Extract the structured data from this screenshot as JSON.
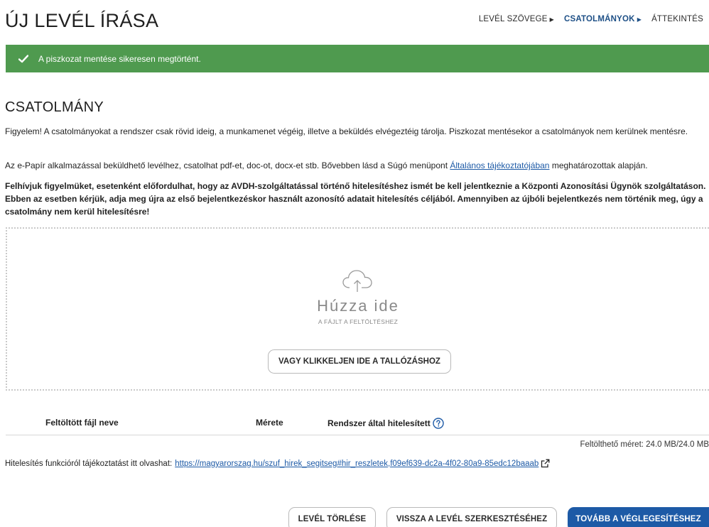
{
  "header": {
    "title": "ÚJ LEVÉL ÍRÁSA",
    "steps": [
      {
        "label": "LEVÉL SZÖVEGE",
        "arrow": "▶",
        "active": false
      },
      {
        "label": "CSATOLMÁNYOK",
        "arrow": "▶",
        "active": true
      },
      {
        "label": "ÁTTEKINTÉS",
        "active": false
      }
    ]
  },
  "alert": {
    "text": "A piszkozat mentése sikeresen megtörtént.",
    "color": "#4f9a4f"
  },
  "attachment": {
    "title": "CSATOLMÁNY",
    "paragraph1": "Figyelem! A csatolmányokat a rendszer csak rövid ideig, a munkamenet végéig, illetve a beküldés elvégeztéig tárolja. Piszkozat mentésekor a csatolmányok nem kerülnek mentésre.",
    "paragraph2_before": "Az e-Papír alkalmazással beküldhető levélhez, csatolhat pdf-et, doc-ot, docx-et stb. Bővebben lásd a Súgó menüpont ",
    "paragraph2_link": "Általános tájékoztatójában",
    "paragraph2_after": " meghatározottak alapján.",
    "paragraph3": "Felhívjuk figyelmüket, esetenként előfordulhat, hogy az AVDH-szolgáltatással történő hitelesítéshez ismét be kell jelentkeznie a Központi Azonosítási Ügynök szolgáltatáson. Ebben az esetben kérjük, adja meg újra az első bejelentkezéskor használt azonosító adatait hitelesítés céljából. Amennyiben az újbóli bejelentkezés nem történik meg, úgy a csatolmány nem kerül hitelesítésre!"
  },
  "dropzone": {
    "main_text": "Húzza ide",
    "sub_text": "A FÁJLT A FELTÖLTÉSHEZ",
    "browse_label": "VAGY KLIKKELJEN IDE A TALLÓZÁSHOZ"
  },
  "file_table": {
    "columns": [
      "Feltöltött fájl neve",
      "Mérete",
      "Rendszer által hitelesített"
    ]
  },
  "capacity_text": "Feltölthető méret: 24.0 MB/24.0 MB",
  "info": {
    "text": "Hitelesítés funkcióról tájékoztatást itt olvashat:",
    "link": "https://magyarorszag.hu/szuf_hirek_segitseg#hir_reszletek,f09ef639-dc2a-4f02-80a9-85edc12baaab"
  },
  "actions": {
    "delete_label": "LEVÉL TÖRLÉSE",
    "back_label": "VISSZA A LEVÉL SZERKESZTÉSÉHEZ",
    "next_label": "TOVÁBB A VÉGLEGESÍTÉSHEZ"
  },
  "colors": {
    "accent": "#1d5aa6",
    "success": "#4f9a4f"
  }
}
